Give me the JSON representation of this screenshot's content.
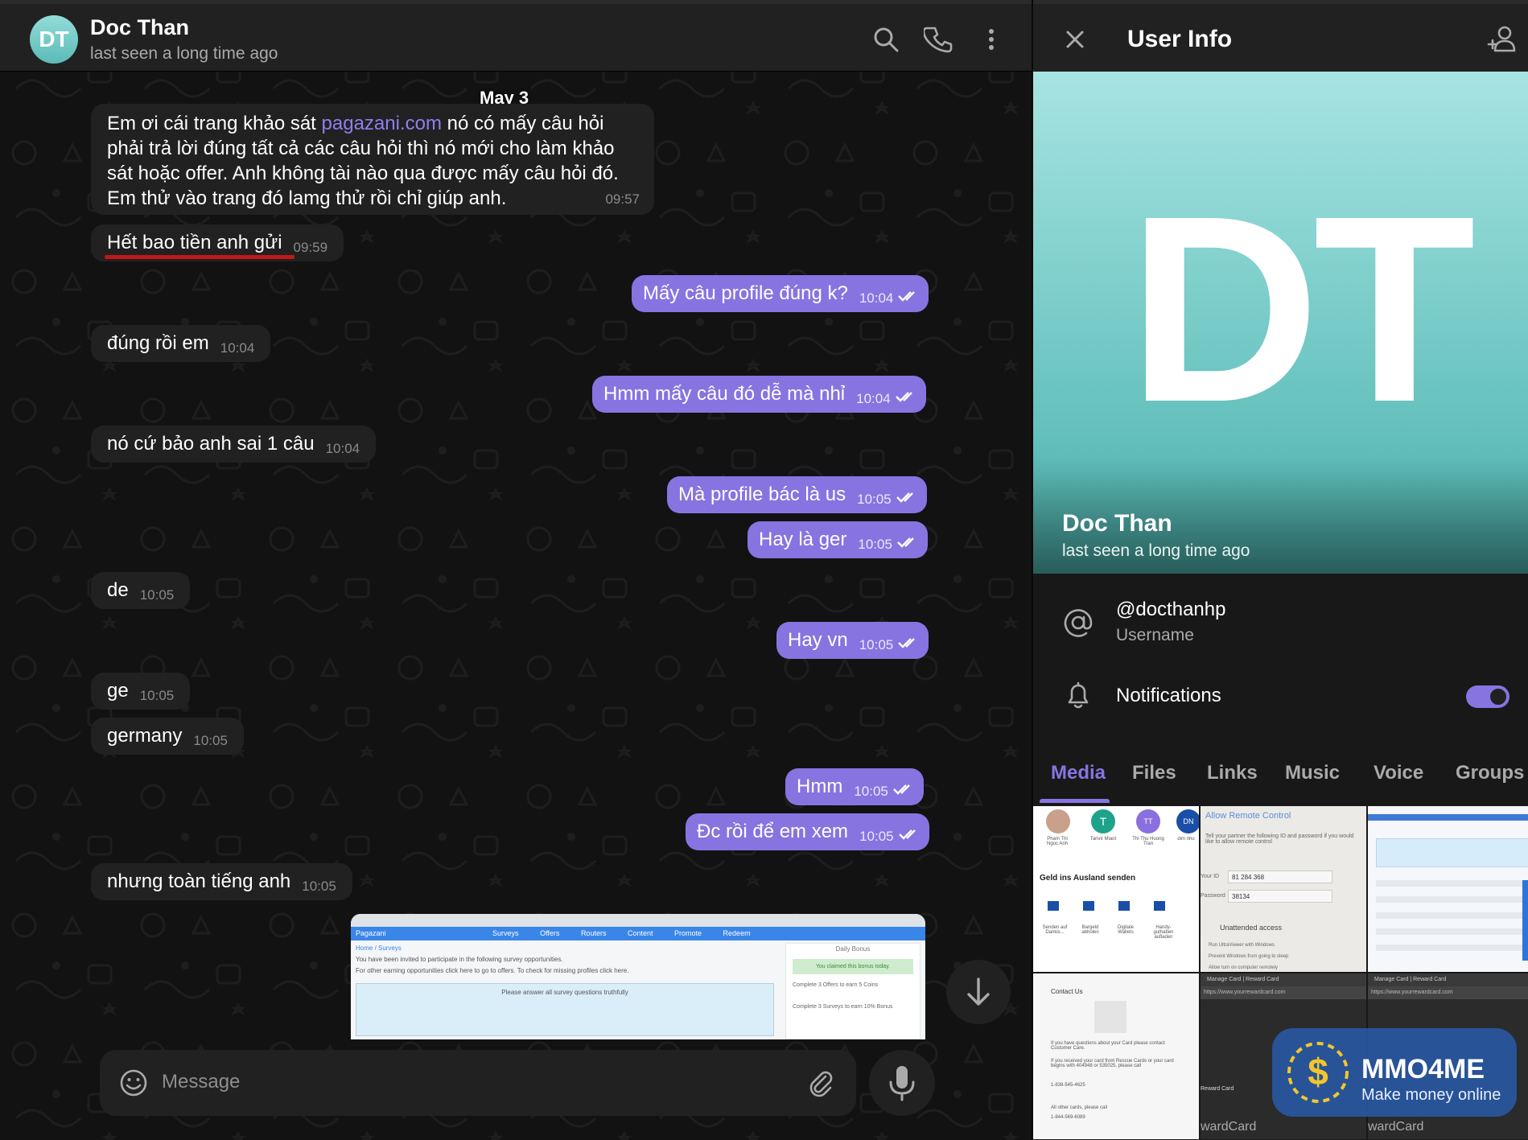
{
  "chat": {
    "header": {
      "avatar_initials": "DT",
      "name": "Doc Than",
      "status": "last seen a long time ago",
      "icons": [
        "search-icon",
        "phone-icon",
        "more-vertical-icon"
      ]
    },
    "date_chip": "May 3",
    "messages": [
      {
        "dir": "in",
        "text_before": "Em ơi cái trang khảo sát ",
        "link": "pagazani.com",
        "text_after": " nó có mấy câu hỏi phải trả lời đúng tất cả các câu hỏi thì nó mới cho làm khảo sát hoặc offer. Anh không tài nào qua được mấy câu hỏi đó. Em thử vào trang đó lamg thử rồi chỉ giúp anh.",
        "time": "09:57"
      },
      {
        "dir": "in",
        "text": "Hết bao tiền anh gửi",
        "time": "09:59"
      },
      {
        "dir": "out",
        "text": "Mấy câu profile đúng k?",
        "time": "10:04"
      },
      {
        "dir": "in",
        "text": "đúng rồi em",
        "time": "10:04"
      },
      {
        "dir": "out",
        "text": "Hmm mấy câu đó dễ mà nhỉ",
        "time": "10:04"
      },
      {
        "dir": "in",
        "text": "nó cứ bảo anh sai 1 câu",
        "time": "10:04"
      },
      {
        "dir": "out",
        "text": "Mà profile bác là us",
        "time": "10:05"
      },
      {
        "dir": "out",
        "text": "Hay là ger",
        "time": "10:05"
      },
      {
        "dir": "in",
        "text": "de",
        "time": "10:05"
      },
      {
        "dir": "out",
        "text": "Hay vn",
        "time": "10:05"
      },
      {
        "dir": "in",
        "text": "ge",
        "time": "10:05"
      },
      {
        "dir": "in",
        "text": "germany",
        "time": "10:05"
      },
      {
        "dir": "out",
        "text": "Hmm",
        "time": "10:05"
      },
      {
        "dir": "out",
        "text": "Đc rồi để em xem",
        "time": "10:05"
      },
      {
        "dir": "in",
        "text": "nhưng toàn tiếng anh",
        "time": "10:05"
      }
    ],
    "composer": {
      "placeholder": "Message"
    },
    "image_preview": {
      "site_name": "Pagazani",
      "nav": [
        "Surveys",
        "Offers",
        "Routers",
        "Content",
        "Promote",
        "Redeem"
      ],
      "breadcrumb": "Home / Surveys",
      "line1": "You have been invited to participate in the following survey opportunities.",
      "line2": "For other earning opportunities click here to go to offers. To check for missing profiles click here.",
      "notice": "Please answer all survey questions truthfully",
      "side_title": "Daily Bonus",
      "side_claimed": "You claimed this bonus today.",
      "side_item1": "Complete 3 Offers to earn 5 Coins",
      "side_item2": "Complete 3 Surveys to earn 10% Bonus"
    }
  },
  "info": {
    "title": "User Info",
    "avatar_initials": "DT",
    "name": "Doc Than",
    "status": "last seen a long time ago",
    "username": "@docthanhp",
    "username_label": "Username",
    "notifications_label": "Notifications",
    "notifications_on": true,
    "tabs": [
      "Media",
      "Files",
      "Links",
      "Music",
      "Voice",
      "Groups"
    ],
    "active_tab": "Media",
    "media": {
      "t1": {
        "title": "Geld ins Ausland senden",
        "contacts": [
          "Pham Thi Ngoc Anh",
          "Tanvir Miaot",
          "Thi Thu Huong Tran",
          "dim nhu"
        ],
        "actions": [
          "Senden auf Dankis...",
          "Bargeld abholen",
          "Digitale Wallets",
          "Handy-guthaben aufladen"
        ]
      },
      "t2": {
        "title": "Allow Remote Control",
        "desc": "Tell your partner the following ID and password if you would like to allow remote control",
        "id_label": "Your ID",
        "id_value": "81 284 368",
        "pw_label": "Password",
        "pw_value": "38134",
        "section": "Unattended access",
        "opt1": "Run UltraViewer with Windows",
        "opt2": "Prevent Windows from going to sleep",
        "opt3": "Allow turn on computer remotely"
      },
      "t4": {
        "title": "Contact Us",
        "line1": "If you have questions about your Card please contact Customer Care.",
        "line2": "If you received your card from Rescue Cards or your card begins with 404948 or 535025, please call",
        "phone1": "1-838-545-4625",
        "line3": "All other cards, please call",
        "phone2": "1-844-569-6089"
      },
      "t5": {
        "tab": "Manage Card | Reward Card",
        "url": "https://www.yourrewardcard.com",
        "card_label": "Reward Card",
        "big": "wardCard"
      },
      "t6": {
        "tab": "Manage Card | Reward Card",
        "url": "https://www.yourrewardcard.com",
        "big": "wardCard"
      }
    }
  },
  "watermark": {
    "title": "MMO4ME",
    "subtitle": "Make money online"
  },
  "colors": {
    "accent": "#8774e1",
    "bubble_in": "#212121",
    "header": "#212121",
    "avatar": "#5cbab7",
    "link": "#8e7ff0",
    "highlight": "#c21717"
  }
}
